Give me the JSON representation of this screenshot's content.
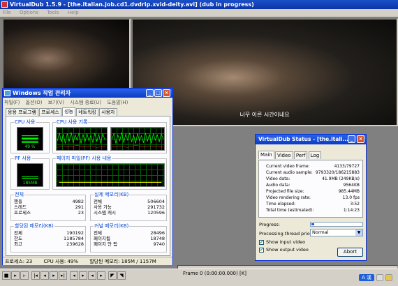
{
  "virtualdub": {
    "title": "VirtualDub 1.5.9 - [the.italian.job.cd1.dvdrip.xvid-deity.avi] (dub in progress)",
    "menu": [
      "File",
      "Options",
      "Tools",
      "Help"
    ],
    "subtitle": "너무 이른 시간이네요",
    "frame_label": "Frame 0 (0:00:00.000) [K]"
  },
  "taskmgr": {
    "title": "Windows 작업 관리자",
    "menu": [
      "파일(F)",
      "옵션(O)",
      "보기(V)",
      "시스템 종료(U)",
      "도움말(H)"
    ],
    "tabs": [
      "응용 프로그램",
      "프로세스",
      "성능",
      "네트워킹",
      "사용자"
    ],
    "active_tab": "성능",
    "cpu_usage_label": "CPU 사용",
    "cpu_history_label": "CPU 사용 기록",
    "cpu_value": "49 %",
    "cpu_fraction": 0.49,
    "pf_usage_label": "PF 사용",
    "pf_history_label": "페이지 파일(PF) 사용 내용",
    "pf_value": "185MB",
    "pf_fraction": 0.16,
    "totals": {
      "label": "전체",
      "rows": [
        {
          "k": "핸들",
          "v": "4982"
        },
        {
          "k": "스레드",
          "v": "291"
        },
        {
          "k": "프로세스",
          "v": "23"
        }
      ]
    },
    "physical": {
      "label": "실제 메모리(KB)",
      "rows": [
        {
          "k": "전체",
          "v": "506604"
        },
        {
          "k": "사용 가능",
          "v": "291732"
        },
        {
          "k": "시스템 캐시",
          "v": "120596"
        }
      ]
    },
    "commit": {
      "label": "할당된 메모리(KB)",
      "rows": [
        {
          "k": "전체",
          "v": "190192"
        },
        {
          "k": "한도",
          "v": "1185784"
        },
        {
          "k": "최고",
          "v": "239628"
        }
      ]
    },
    "kernel": {
      "label": "커널 메모리(KB)",
      "rows": [
        {
          "k": "전체",
          "v": "28496"
        },
        {
          "k": "페이지됨",
          "v": "18748"
        },
        {
          "k": "페이지 안 됨",
          "v": "9740"
        }
      ]
    },
    "status": {
      "processes": "프로세스: 23",
      "cpu": "CPU 사용: 49%",
      "commit": "할당된 메모리: 185M / 1157M"
    }
  },
  "dubstatus": {
    "title": "VirtualDub Status - [the.itali...",
    "tabs": [
      "Main",
      "Video",
      "Perf",
      "Log"
    ],
    "rows": [
      {
        "k": "Current video frame:",
        "v": "4133/79727"
      },
      {
        "k": "Current audio sample:",
        "v": "9793320/186215883"
      },
      {
        "k": "Video data:",
        "v": "41.9MB (249KB/s)"
      },
      {
        "k": "Audio data:",
        "v": "9564KB"
      },
      {
        "k": "Projected file size:",
        "v": "985.44MB"
      },
      {
        "k": "Video rendering rate:",
        "v": "13.0 fps"
      },
      {
        "k": "Time elapsed:",
        "v": "3:52"
      },
      {
        "k": "Total time (estimated):",
        "v": "1:14:23"
      }
    ],
    "progress_label": "Progress:",
    "progress_fraction": 0.05,
    "priority_label": "Processing thread priority:",
    "priority_value": "Normal",
    "show_input": "Show input video",
    "show_output": "Show output video",
    "abort": "Abort"
  },
  "tray": {
    "text": "A 漢"
  }
}
